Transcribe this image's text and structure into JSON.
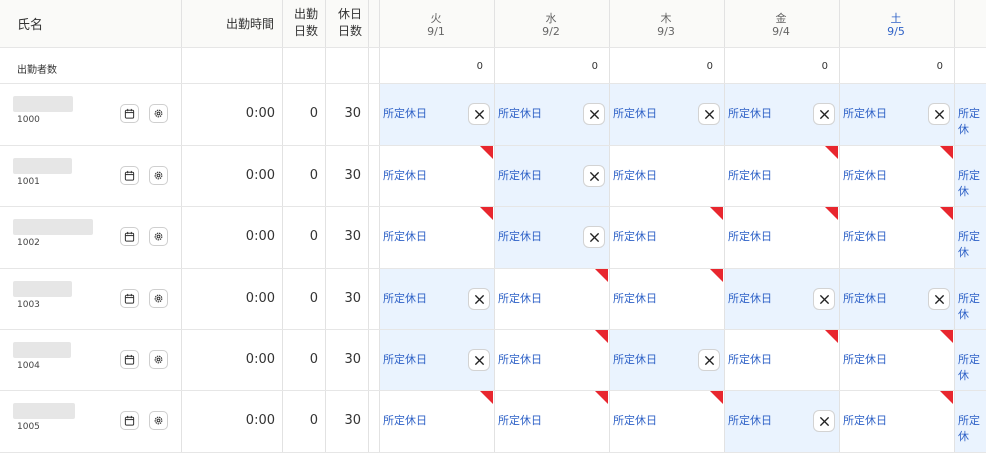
{
  "header": {
    "name": "氏名",
    "work_time": "出勤時間",
    "work_days": [
      "出勤",
      "日数"
    ],
    "holiday_days": [
      "休日",
      "日数"
    ],
    "days": [
      {
        "dow": "火",
        "date": "9/1",
        "saturday": false
      },
      {
        "dow": "水",
        "date": "9/2",
        "saturday": false
      },
      {
        "dow": "木",
        "date": "9/3",
        "saturday": false
      },
      {
        "dow": "金",
        "date": "9/4",
        "saturday": false
      },
      {
        "dow": "土",
        "date": "9/5",
        "saturday": true
      }
    ]
  },
  "attendance_count": {
    "label": "出勤者数",
    "values": [
      "0",
      "0",
      "0",
      "0",
      "0"
    ]
  },
  "employees": [
    {
      "id": "1000",
      "time": "0:00",
      "work_days": "0",
      "holidays": "30",
      "days": [
        {
          "label": "所定休日",
          "x": true,
          "flag": false
        },
        {
          "label": "所定休日",
          "x": true,
          "flag": false
        },
        {
          "label": "所定休日",
          "x": true,
          "flag": false
        },
        {
          "label": "所定休日",
          "x": true,
          "flag": false
        },
        {
          "label": "所定休日",
          "x": true,
          "flag": false
        },
        {
          "label": "所定休",
          "x": false,
          "flag": false
        }
      ]
    },
    {
      "id": "1001",
      "time": "0:00",
      "work_days": "0",
      "holidays": "30",
      "days": [
        {
          "label": "所定休日",
          "x": false,
          "flag": true
        },
        {
          "label": "所定休日",
          "x": true,
          "flag": false
        },
        {
          "label": "所定休日",
          "x": false,
          "flag": false
        },
        {
          "label": "所定休日",
          "x": false,
          "flag": true
        },
        {
          "label": "所定休日",
          "x": false,
          "flag": true
        },
        {
          "label": "所定休",
          "x": false,
          "flag": false
        }
      ]
    },
    {
      "id": "1002",
      "time": "0:00",
      "work_days": "0",
      "holidays": "30",
      "days": [
        {
          "label": "所定休日",
          "x": false,
          "flag": true
        },
        {
          "label": "所定休日",
          "x": true,
          "flag": false
        },
        {
          "label": "所定休日",
          "x": false,
          "flag": true
        },
        {
          "label": "所定休日",
          "x": false,
          "flag": true
        },
        {
          "label": "所定休日",
          "x": false,
          "flag": true
        },
        {
          "label": "所定休",
          "x": false,
          "flag": false
        }
      ]
    },
    {
      "id": "1003",
      "time": "0:00",
      "work_days": "0",
      "holidays": "30",
      "days": [
        {
          "label": "所定休日",
          "x": true,
          "flag": false
        },
        {
          "label": "所定休日",
          "x": false,
          "flag": true
        },
        {
          "label": "所定休日",
          "x": false,
          "flag": true
        },
        {
          "label": "所定休日",
          "x": true,
          "flag": false
        },
        {
          "label": "所定休日",
          "x": true,
          "flag": false
        },
        {
          "label": "所定休",
          "x": false,
          "flag": false
        }
      ]
    },
    {
      "id": "1004",
      "time": "0:00",
      "work_days": "0",
      "holidays": "30",
      "days": [
        {
          "label": "所定休日",
          "x": true,
          "flag": false
        },
        {
          "label": "所定休日",
          "x": false,
          "flag": true
        },
        {
          "label": "所定休日",
          "x": true,
          "flag": false
        },
        {
          "label": "所定休日",
          "x": false,
          "flag": true
        },
        {
          "label": "所定休日",
          "x": false,
          "flag": true
        },
        {
          "label": "所定休",
          "x": false,
          "flag": false
        }
      ]
    },
    {
      "id": "1005",
      "time": "0:00",
      "work_days": "0",
      "holidays": "30",
      "days": [
        {
          "label": "所定休日",
          "x": false,
          "flag": true
        },
        {
          "label": "所定休日",
          "x": false,
          "flag": true
        },
        {
          "label": "所定休日",
          "x": false,
          "flag": true
        },
        {
          "label": "所定休日",
          "x": true,
          "flag": false
        },
        {
          "label": "所定休日",
          "x": false,
          "flag": true
        },
        {
          "label": "所定休",
          "x": false,
          "flag": false
        }
      ]
    }
  ],
  "colors": {
    "holiday_text": "#2f62c7",
    "selected_cell": "#eaf3fe",
    "flag": "#e8262e",
    "saturday": "#2f62c7"
  },
  "icons": {
    "calendar": "calendar-icon",
    "settings": "gear-icon",
    "remove": "close-icon"
  }
}
